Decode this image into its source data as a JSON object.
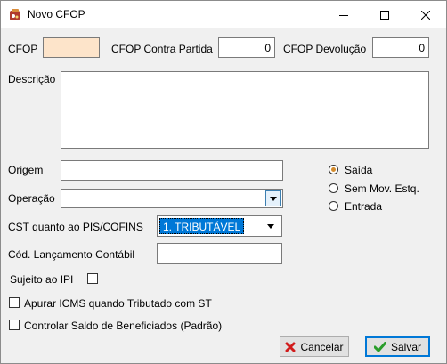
{
  "window": {
    "title": "Novo CFOP"
  },
  "fields": {
    "cfop_label": "CFOP",
    "cfop_value": "",
    "contra_partida_label": "CFOP Contra Partida",
    "contra_partida_value": "0",
    "devolucao_label": "CFOP Devolução",
    "devolucao_value": "0",
    "descricao_label": "Descrição",
    "descricao_value": "",
    "origem_label": "Origem",
    "origem_value": "",
    "operacao_label": "Operação",
    "operacao_value": "",
    "cst_label": "CST quanto ao PIS/COFINS",
    "cst_value": "1. TRIBUTÁVEL",
    "cod_lancamento_label": "Cód. Lançamento Contábil",
    "cod_lancamento_value": "",
    "sujeito_ipi_label": "Sujeito ao IPI"
  },
  "radio_options": [
    {
      "label": "Saída",
      "checked": true
    },
    {
      "label": "Sem Mov. Estq.",
      "checked": false
    },
    {
      "label": "Entrada",
      "checked": false
    }
  ],
  "checkboxes": {
    "apurar_icms_label": "Apurar ICMS quando Tributado com ST",
    "controlar_saldo_label": "Controlar Saldo de Beneficiados (Padrão)"
  },
  "buttons": {
    "cancel_label": "Cancelar",
    "save_label": "Salvar"
  },
  "colors": {
    "cfop_field_bg": "#fde4ca",
    "selection_bg": "#0078d7",
    "cancel_icon": "#d11b1b",
    "save_icon": "#2a9d2a"
  }
}
